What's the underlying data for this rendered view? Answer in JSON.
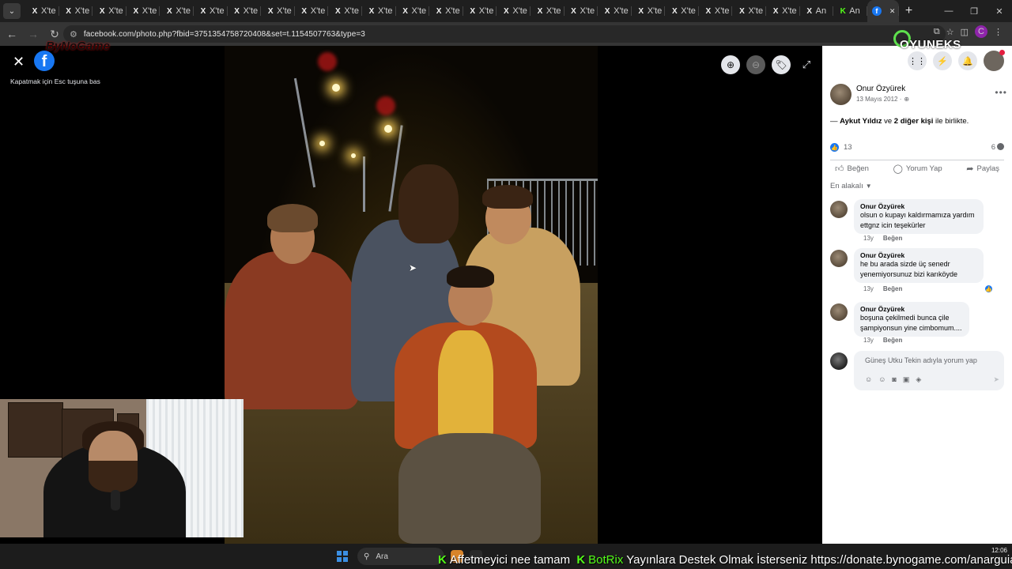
{
  "browser": {
    "tabs": [
      {
        "label": "X'te",
        "icon": "x-icon"
      },
      {
        "label": "X'te",
        "icon": "x-icon"
      },
      {
        "label": "X'te",
        "icon": "x-icon"
      },
      {
        "label": "X'te",
        "icon": "x-icon"
      },
      {
        "label": "X'te",
        "icon": "x-icon"
      },
      {
        "label": "X'te",
        "icon": "x-icon"
      },
      {
        "label": "X'te",
        "icon": "x-icon"
      },
      {
        "label": "X'te",
        "icon": "x-icon"
      },
      {
        "label": "X'te",
        "icon": "x-icon"
      },
      {
        "label": "X'te",
        "icon": "x-icon"
      },
      {
        "label": "X'te",
        "icon": "x-icon"
      },
      {
        "label": "X'te",
        "icon": "x-icon"
      },
      {
        "label": "X'te",
        "icon": "x-icon"
      },
      {
        "label": "X'te",
        "icon": "x-icon"
      },
      {
        "label": "X'te",
        "icon": "x-icon"
      },
      {
        "label": "X'te",
        "icon": "x-icon"
      },
      {
        "label": "X'te",
        "icon": "x-icon"
      },
      {
        "label": "X'te",
        "icon": "x-icon"
      },
      {
        "label": "X'te",
        "icon": "x-icon"
      },
      {
        "label": "X'te",
        "icon": "x-icon"
      },
      {
        "label": "X'te",
        "icon": "x-icon"
      },
      {
        "label": "X'te",
        "icon": "x-icon"
      },
      {
        "label": "X'te",
        "icon": "x-icon"
      },
      {
        "label": "An",
        "icon": "x-icon"
      },
      {
        "label": "An",
        "icon": "kick-icon"
      }
    ],
    "active_tab": {
      "icon": "facebook-icon",
      "close": "✕"
    },
    "new_tab": "+",
    "url": "facebook.com/photo.php?fbid=3751354758720408&set=t.1154507763&type=3",
    "profile_initial": "C"
  },
  "viewer": {
    "esc_hint": "Kapatmak için Esc tuşuna bas",
    "overlay_brand": "ByNoGame"
  },
  "panel": {
    "brand": "OYUNEKS",
    "post": {
      "author": "Onur Özyürek",
      "date": "13 Mayıs 2012 ·",
      "tag_prefix": "— ",
      "tag_person": "Aykut Yıldız",
      "tag_and": " ve ",
      "tag_others": "2 diğer kişi",
      "tag_suffix": " ile birlikte.",
      "like_count": "13",
      "comment_count": "6"
    },
    "actions": {
      "like": "Beğen",
      "comment": "Yorum Yap",
      "share": "Paylaş"
    },
    "sort_label": "En alakalı",
    "comments": [
      {
        "author": "Onur Özyürek",
        "text": "olsun o kupayı kaldırmamıza yardım ettgnz icin teşekürler",
        "age": "13y",
        "like": "Beğen"
      },
      {
        "author": "Onur Özyürek",
        "text": "he bu arada sizde üç senedr yenemiyorsunuz bizi karıköyde",
        "age": "13y",
        "like": "Beğen"
      },
      {
        "author": "Onur Özyürek",
        "text": "boşuna çekilmedi bunca çile şampiyonsun yine cimbomum....",
        "age": "13y",
        "like": "Beğen"
      }
    ],
    "composer_placeholder": "Güneş Utku Tekin adıyla yorum yap"
  },
  "taskbar": {
    "search_label": "Ara",
    "ticker_part1": "Affetmeyici nee tamam",
    "ticker_part2": "BotRix",
    "ticker_part3": "Yayınlara Destek Olmak İsterseniz https://donate.bynogame.com/anarguia",
    "time": "12:06"
  },
  "colors": {
    "facebook_blue": "#1877f2",
    "kick_green": "#53fc18",
    "panel_bg": "#ffffff",
    "viewer_bg": "#000000"
  }
}
